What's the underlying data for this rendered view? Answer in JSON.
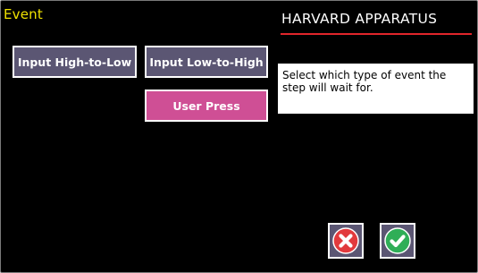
{
  "screen": {
    "title": "Event",
    "brand": "HARVARD APPARATUS"
  },
  "options": {
    "high_to_low": "Input High-to-Low",
    "low_to_high": "Input Low-to-High",
    "user_press": "User Press"
  },
  "help_text": "Select which type of event the step will wait for.",
  "actions": {
    "cancel_icon": "cancel-x-icon",
    "confirm_icon": "confirm-check-icon"
  },
  "colors": {
    "background": "#000000",
    "title": "#f1e300",
    "brand_rule": "#e0252b",
    "button": "#5b5673",
    "selected_button": "#cf4f95",
    "cancel": "#e23a3d",
    "confirm": "#2fae57"
  }
}
